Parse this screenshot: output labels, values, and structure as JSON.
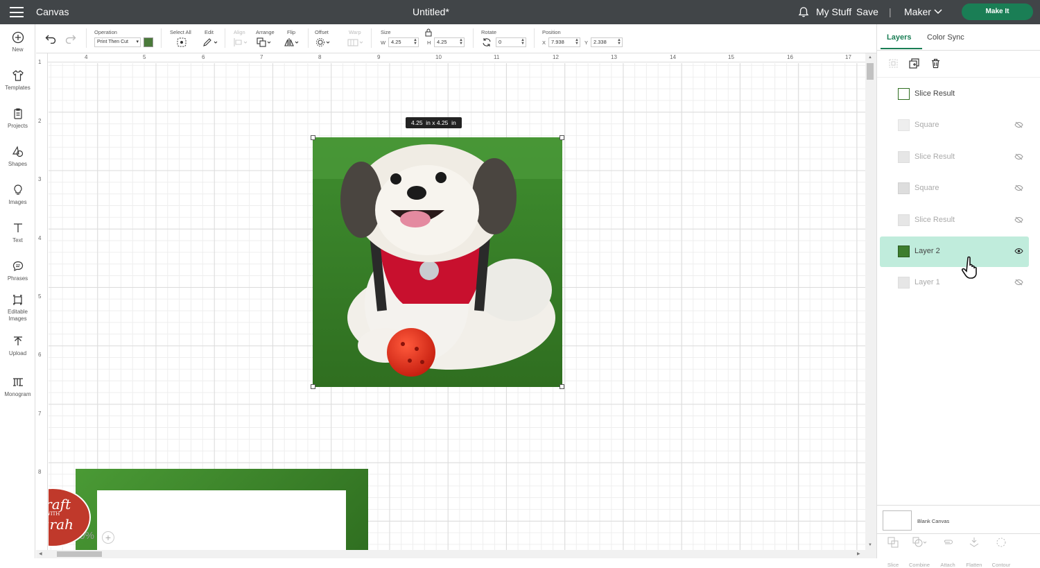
{
  "topbar": {
    "section": "Canvas",
    "title": "Untitled*",
    "my_stuff": "My Stuff",
    "save": "Save",
    "divider": "|",
    "machine": "Maker",
    "make_it": "Make It"
  },
  "left_nav": [
    {
      "label": "New",
      "icon": "plus-circle-icon"
    },
    {
      "label": "Templates",
      "icon": "tshirt-icon"
    },
    {
      "label": "Projects",
      "icon": "clipboard-icon"
    },
    {
      "label": "Shapes",
      "icon": "shapes-icon"
    },
    {
      "label": "Images",
      "icon": "lightbulb-icon"
    },
    {
      "label": "Text",
      "icon": "text-icon"
    },
    {
      "label": "Phrases",
      "icon": "speech-bubble-icon"
    },
    {
      "label": "Editable Images",
      "icon": "editable-image-icon"
    },
    {
      "label": "Upload",
      "icon": "upload-icon"
    },
    {
      "label": "Monogram",
      "icon": "monogram-icon"
    }
  ],
  "toolbar": {
    "operation_label": "Operation",
    "operation_value": "Print Then Cut",
    "select_all": "Select All",
    "edit": "Edit",
    "align": "Align",
    "arrange": "Arrange",
    "flip": "Flip",
    "offset": "Offset",
    "warp": "Warp",
    "size": "Size",
    "w_label": "W",
    "w_value": "4.25",
    "h_label": "H",
    "h_value": "4.25",
    "rotate": "Rotate",
    "rotate_value": "0",
    "position": "Position",
    "x_label": "X",
    "x_value": "7.938",
    "y_label": "Y",
    "y_value": "2.338"
  },
  "ruler": {
    "top": [
      "4",
      "5",
      "6",
      "7",
      "8",
      "9",
      "10",
      "11",
      "12",
      "13",
      "14",
      "15",
      "16",
      "17"
    ],
    "left": [
      "1",
      "2",
      "3",
      "4",
      "5",
      "6",
      "7",
      "8"
    ]
  },
  "canvas": {
    "size_tooltip": "4.25  in x 4.25  in",
    "zoom": "50%"
  },
  "layers_panel": {
    "tab_layers": "Layers",
    "tab_color_sync": "Color Sync",
    "layers": [
      {
        "label": "Slice Result",
        "visible": true,
        "selected": false
      },
      {
        "label": "Square",
        "visible": false,
        "selected": false
      },
      {
        "label": "Slice Result",
        "visible": false,
        "selected": false
      },
      {
        "label": "Square",
        "visible": false,
        "selected": false
      },
      {
        "label": "Slice Result",
        "visible": false,
        "selected": false
      },
      {
        "label": "Layer 2",
        "visible": true,
        "selected": true
      },
      {
        "label": "Layer 1",
        "visible": false,
        "selected": false
      }
    ],
    "blank_canvas": "Blank Canvas",
    "bottom_tools": [
      "Slice",
      "Combine",
      "Attach",
      "Flatten",
      "Contour"
    ]
  },
  "watermark": {
    "line1": "Craft",
    "with": "WITH",
    "line2": "Sarah"
  },
  "colors": {
    "topbar": "#414548",
    "accent": "#1a7e55",
    "selected_layer": "#c0ecdc",
    "grass": "#3d8a2c"
  }
}
